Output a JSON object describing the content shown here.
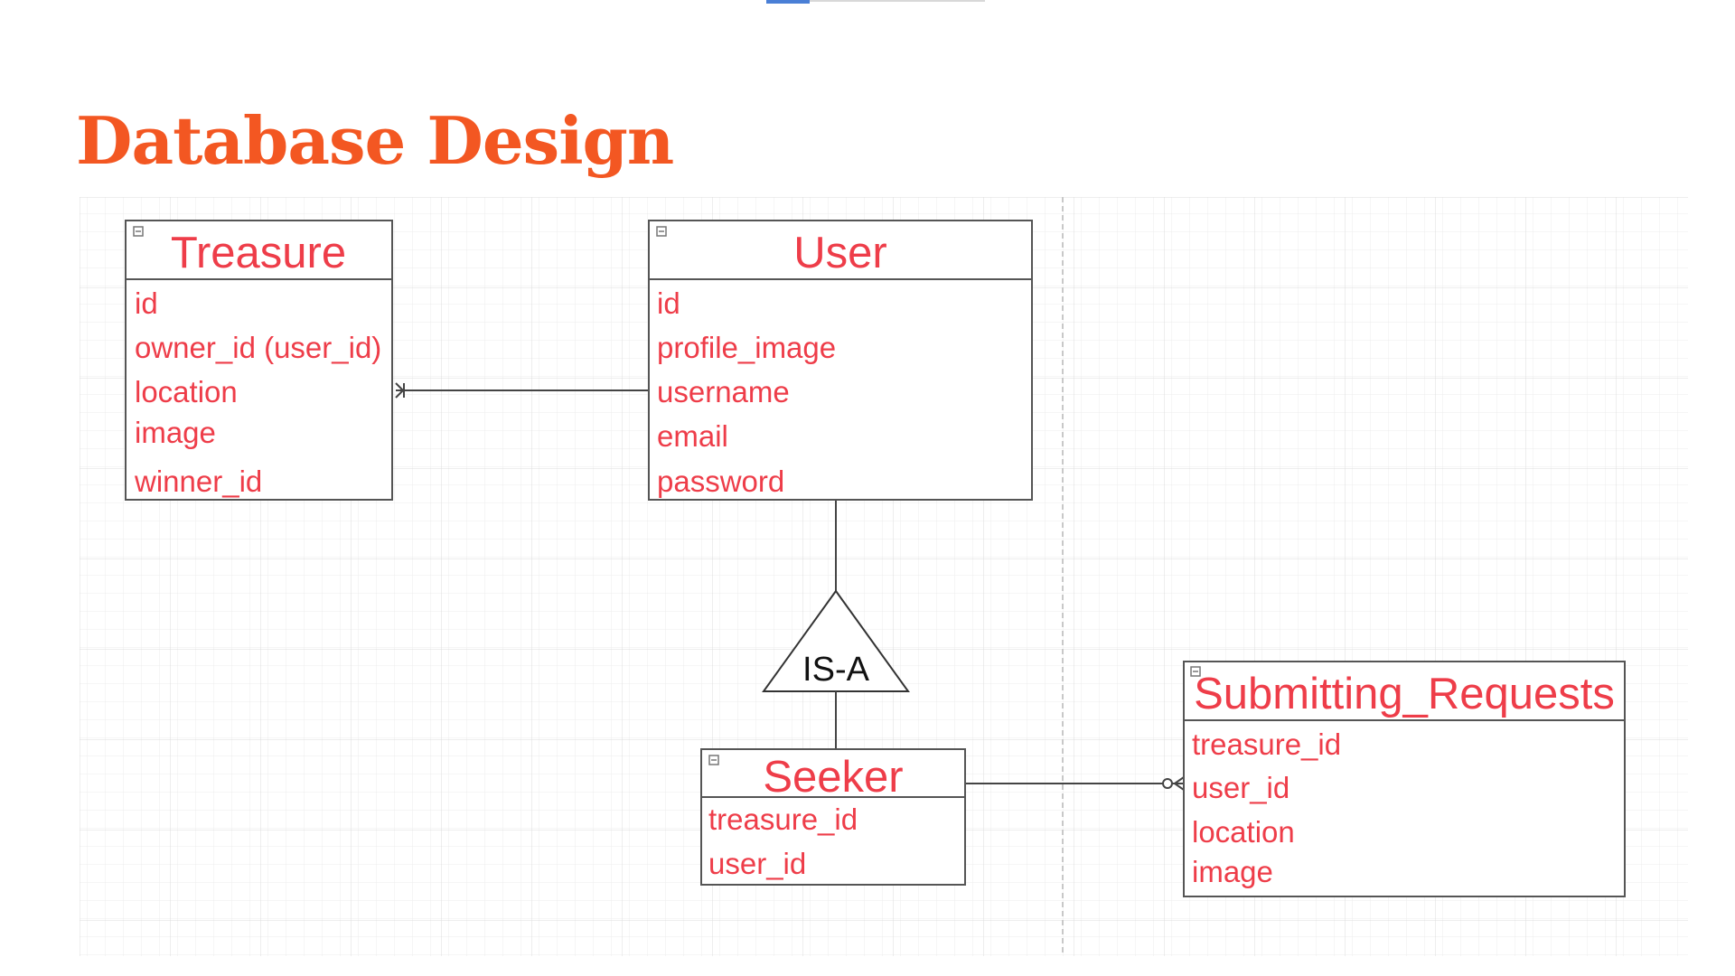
{
  "title": "Database Design",
  "colors": {
    "title": "#f35722",
    "entity_text": "#ee3d49",
    "line": "#444444",
    "grid": "#e6e6e6"
  },
  "diagram": {
    "entities": [
      {
        "name": "Treasure",
        "attributes": [
          "id",
          "owner_id (user_id)",
          "location",
          "image",
          "winner_id"
        ]
      },
      {
        "name": "User",
        "attributes": [
          "id",
          "profile_image",
          "username",
          "email",
          "password"
        ]
      },
      {
        "name": "Seeker",
        "attributes": [
          "treasure_id",
          "user_id"
        ]
      },
      {
        "name": "Submitting_Requests",
        "attributes": [
          "treasure_id",
          "user_id",
          "location",
          "image"
        ]
      }
    ],
    "isa_label": "IS-A",
    "relationships": [
      {
        "from": "User",
        "to": "Treasure",
        "end_notation": "one-or-many"
      },
      {
        "from": "Seeker",
        "to": "Submitting_Requests",
        "end_notation": "zero-or-many"
      },
      {
        "from": "User",
        "to": "Seeker",
        "type": "IS-A"
      }
    ]
  }
}
